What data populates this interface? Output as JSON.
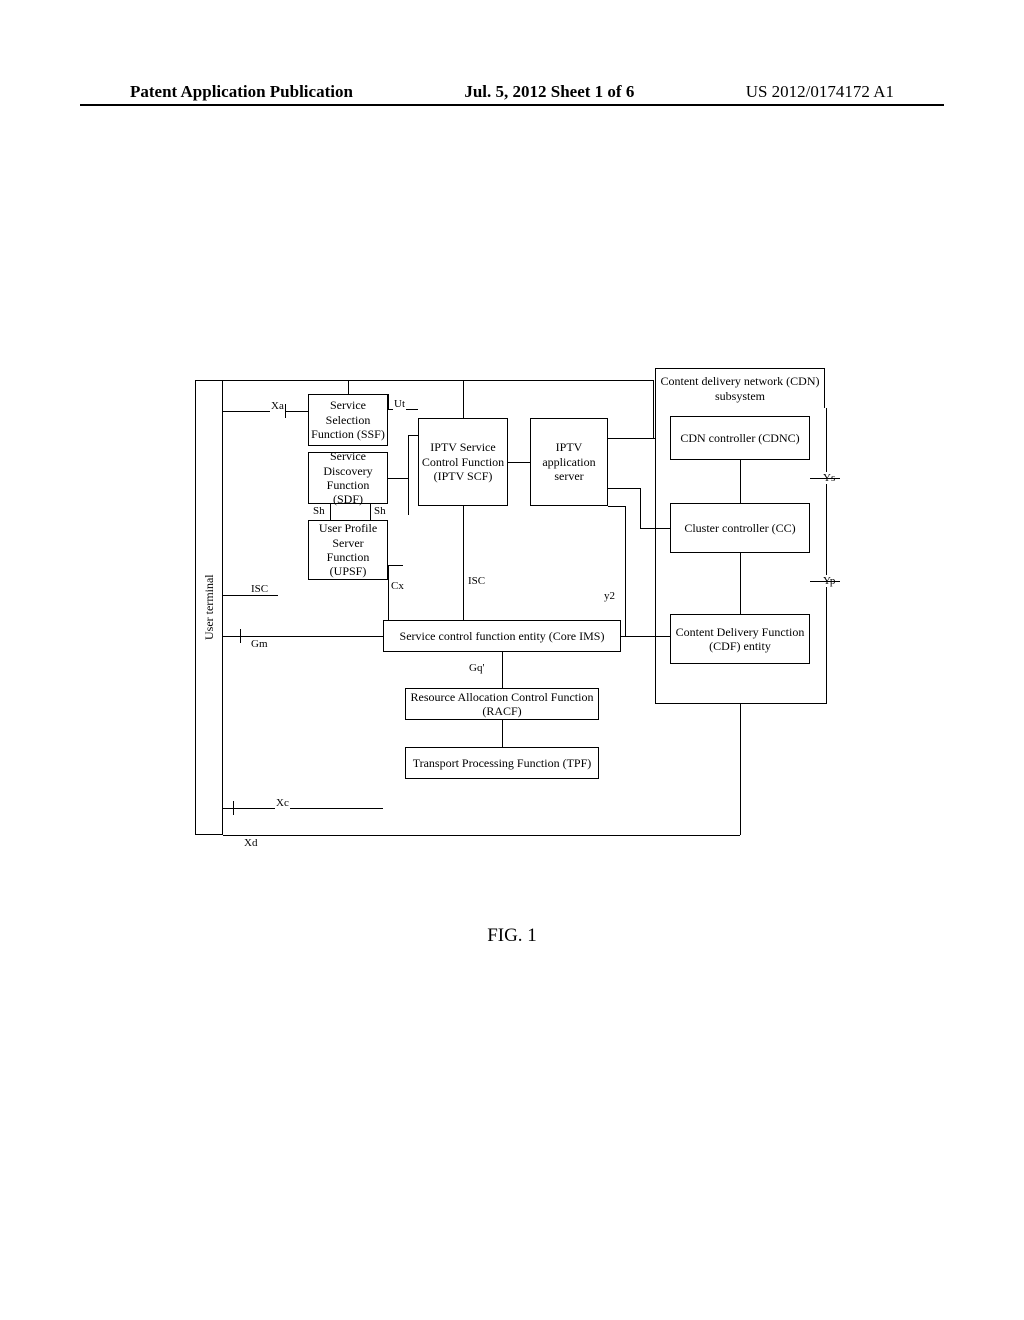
{
  "header": {
    "left": "Patent Application Publication",
    "center": "Jul. 5, 2012   Sheet 1 of 6",
    "right": "US 2012/0174172 A1"
  },
  "diagram": {
    "user_terminal": "User terminal",
    "cdn_subsystem": "Content delivery network (CDN) subsystem",
    "ssf": "Service Selection Function (SSF)",
    "sdf": "Service Discovery Function (SDF)",
    "upsf": "User Profile Server Function (UPSF)",
    "iptv_scf": "IPTV Service Control Function (IPTV SCF)",
    "iptv_app": "IPTV application server",
    "cdnc": "CDN controller (CDNC)",
    "cc": "Cluster controller (CC)",
    "cdf": "Content Delivery Function (CDF) entity",
    "core_ims": "Service control function entity (Core IMS)",
    "racf": "Resource Allocation Control Function (RACF)",
    "tpf": "Transport Processing Function (TPF)"
  },
  "labels": {
    "Xa": "Xa",
    "Ut": "Ut",
    "ISC_left": "ISC",
    "Sh1": "Sh",
    "Sh2": "Sh",
    "Cx": "Cx",
    "ISC_mid": "ISC",
    "y2": "y2",
    "Gm": "Gm",
    "Gq": "Gq'",
    "Xc": "Xc",
    "Ys": "Ys",
    "Yp": "Yp",
    "Xd": "Xd"
  },
  "figure_caption": "FIG. 1"
}
